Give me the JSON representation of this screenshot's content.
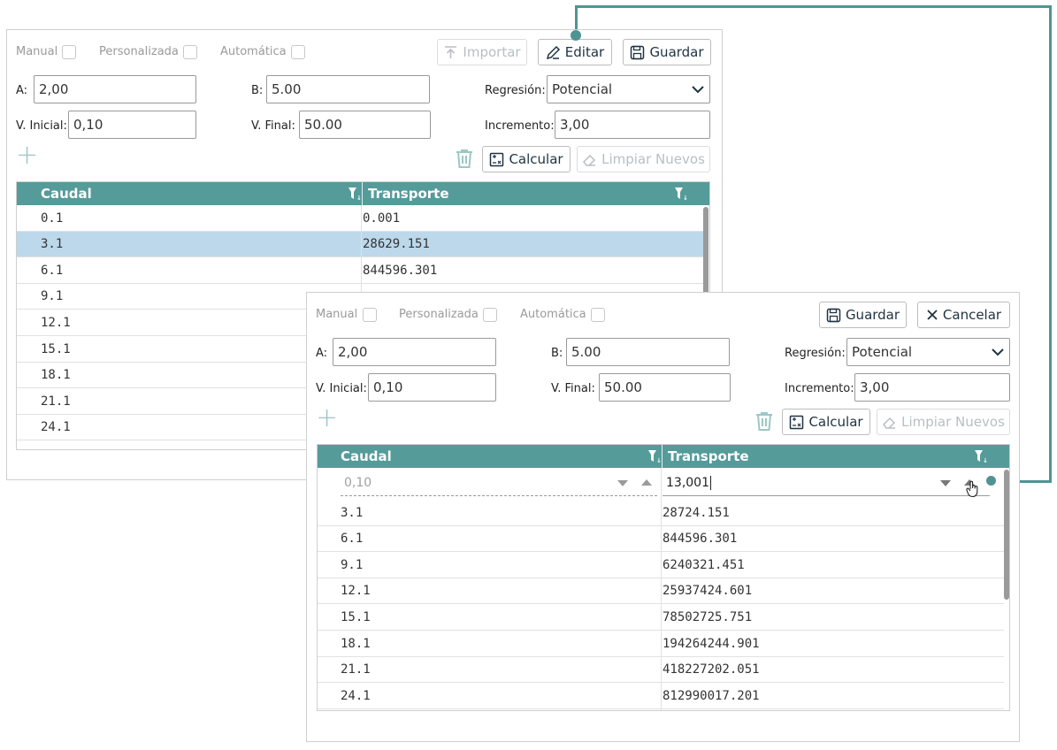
{
  "back": {
    "checks": [
      "Manual",
      "Personalizada",
      "Automática"
    ],
    "buttons": {
      "import": "Importar",
      "edit": "Editar",
      "save": "Guardar"
    },
    "fields": {
      "a_label": "A:",
      "a_value": "2,00",
      "b_label": "B:",
      "b_value": "5.00",
      "regresion_label": "Regresión:",
      "regresion_value": "Potencial",
      "v_inicial_label": "V. Inicial:",
      "v_inicial_value": "0,10",
      "v_final_label": "V. Final:",
      "v_final_value": "50.00",
      "incremento_label": "Incremento:",
      "incremento_value": "3,00"
    },
    "actions": {
      "calcular": "Calcular",
      "limpiar": "Limpiar Nuevos"
    },
    "grid": {
      "columns": [
        "Caudal",
        "Transporte"
      ],
      "rows": [
        [
          "0.1",
          "0.001"
        ],
        [
          "3.1",
          "28629.151"
        ],
        [
          "6.1",
          "844596.301"
        ],
        [
          "9.1",
          ""
        ],
        [
          "12.1",
          ""
        ],
        [
          "15.1",
          ""
        ],
        [
          "18.1",
          ""
        ],
        [
          "21.1",
          ""
        ],
        [
          "24.1",
          ""
        ]
      ],
      "selected_row": 1
    }
  },
  "front": {
    "checks": [
      "Manual",
      "Personalizada",
      "Automática"
    ],
    "buttons": {
      "save": "Guardar",
      "cancel": "Cancelar"
    },
    "fields": {
      "a_label": "A:",
      "a_value": "2,00",
      "b_label": "B:",
      "b_value": "5.00",
      "regresion_label": "Regresión:",
      "regresion_value": "Potencial",
      "v_inicial_label": "V. Inicial:",
      "v_inicial_value": "0,10",
      "v_final_label": "V. Final:",
      "v_final_value": "50.00",
      "incremento_label": "Incremento:",
      "incremento_value": "3,00"
    },
    "actions": {
      "calcular": "Calcular",
      "limpiar": "Limpiar Nuevos"
    },
    "grid": {
      "columns": [
        "Caudal",
        "Transporte"
      ],
      "editor": {
        "caudal_value": "0,10",
        "transporte_value": "13,001"
      },
      "rows": [
        [
          "3.1",
          "28724.151"
        ],
        [
          "6.1",
          "844596.301"
        ],
        [
          "9.1",
          "6240321.451"
        ],
        [
          "12.1",
          "25937424.601"
        ],
        [
          "15.1",
          "78502725.751"
        ],
        [
          "18.1",
          "194264244.901"
        ],
        [
          "21.1",
          "418227202.051"
        ],
        [
          "24.1",
          "812990017.201"
        ]
      ]
    }
  },
  "colors": {
    "header": "#559b9a",
    "selected_row": "#bcd8ea",
    "connector": "#4e9493"
  }
}
